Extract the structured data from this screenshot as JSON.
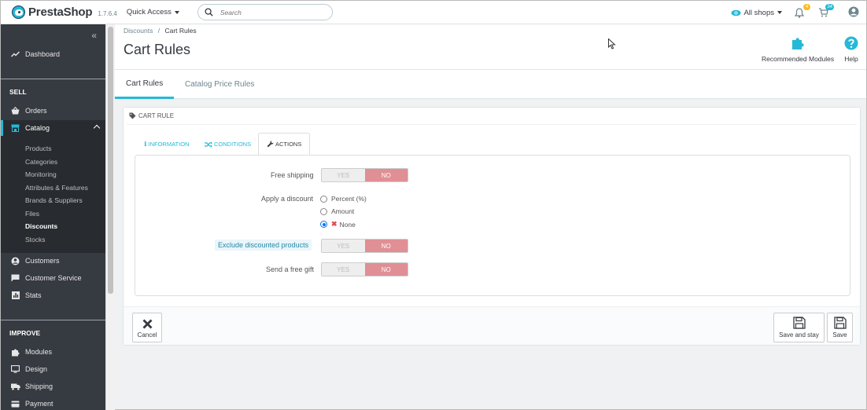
{
  "header": {
    "brand": "PrestaShop",
    "version": "1.7.6.4",
    "quick_access": "Quick Access",
    "search_placeholder": "Search",
    "shops": "All shops",
    "notifications_count": "4",
    "orders_count": "34"
  },
  "sidebar": {
    "dashboard": "Dashboard",
    "section_sell": "SELL",
    "orders": "Orders",
    "catalog": "Catalog",
    "catalog_sub": [
      "Products",
      "Categories",
      "Monitoring",
      "Attributes & Features",
      "Brands & Suppliers",
      "Files",
      "Discounts",
      "Stocks"
    ],
    "customers": "Customers",
    "customer_service": "Customer Service",
    "stats": "Stats",
    "section_improve": "IMPROVE",
    "modules": "Modules",
    "design": "Design",
    "shipping": "Shipping",
    "payment": "Payment"
  },
  "page": {
    "breadcrumb_parent": "Discounts",
    "breadcrumb_sep": "/",
    "breadcrumb_current": "Cart Rules",
    "title": "Cart Rules",
    "recommended_modules": "Recommended Modules",
    "help": "Help"
  },
  "tabs": {
    "cart_rules": "Cart Rules",
    "catalog_price_rules": "Catalog Price Rules"
  },
  "panel": {
    "heading": "Cart rule",
    "tab_information": "Information",
    "tab_conditions": "Conditions",
    "tab_actions": "Actions",
    "free_shipping_label": "Free shipping",
    "apply_discount_label": "Apply a discount",
    "option_percent": "Percent (%)",
    "option_amount": "Amount",
    "option_none": "None",
    "exclude_label": "Exclude discounted products",
    "free_gift_label": "Send a free gift",
    "yes": "YES",
    "no": "NO",
    "cancel": "Cancel",
    "save_and_stay": "Save and stay",
    "save": "Save"
  },
  "colors": {
    "accent": "#25b9d7",
    "sidebar_bg": "#363a41",
    "switch_no": "#e08f95",
    "active_tab_underline": "#e31b1b"
  }
}
